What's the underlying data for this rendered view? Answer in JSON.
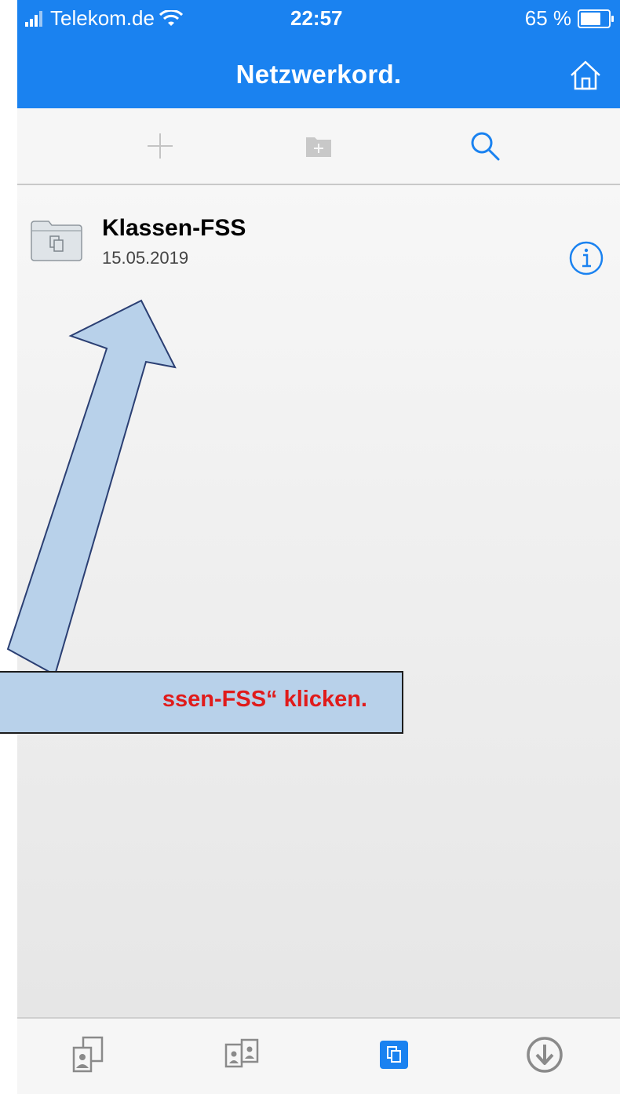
{
  "status_bar": {
    "carrier": "Telekom.de",
    "time": "22:57",
    "battery": "65 %"
  },
  "nav": {
    "title": "Netzwerkord."
  },
  "toolbar": {
    "icons": [
      "plus-icon",
      "new-folder-icon",
      "search-icon"
    ]
  },
  "items": [
    {
      "name": "Klassen-FSS",
      "date": "15.05.2019",
      "icon": "network-folder-icon"
    }
  ],
  "tabbar": {
    "icons": [
      "documents-icon",
      "shared-icon",
      "network-folder-icon",
      "download-icon"
    ],
    "active_index": 2
  },
  "annotation": {
    "text": "ssen-FSS“ klicken."
  },
  "colors": {
    "accent": "#1a82f0",
    "callout_bg": "#b8d1ea",
    "callout_text": "#e01b1b"
  }
}
